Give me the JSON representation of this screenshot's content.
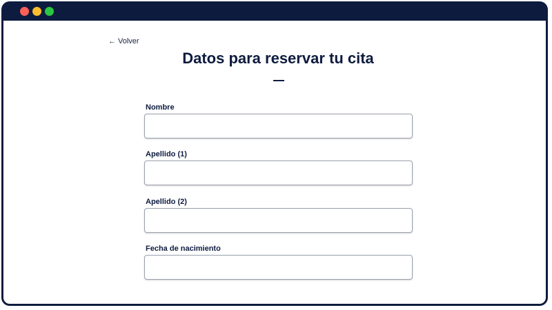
{
  "window": {
    "controls": {
      "close_color": "#ff5f57",
      "minimize_color": "#febc2e",
      "maximize_color": "#28c840"
    },
    "frame_color": "#0d1b3e"
  },
  "nav": {
    "back_icon": "arrow-left-icon",
    "back_label": "Volver"
  },
  "header": {
    "title": "Datos para reservar tu cita"
  },
  "form": {
    "fields": [
      {
        "label": "Nombre",
        "value": "",
        "placeholder": ""
      },
      {
        "label": "Apellido (1)",
        "value": "",
        "placeholder": ""
      },
      {
        "label": "Apellido (2)",
        "value": "",
        "placeholder": ""
      },
      {
        "label": "Fecha de nacimiento",
        "value": "",
        "placeholder": ""
      }
    ]
  }
}
